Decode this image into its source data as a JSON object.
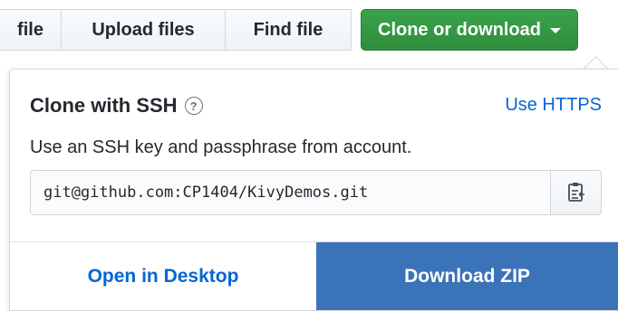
{
  "toolbar": {
    "file_label": "file",
    "upload_label": "Upload files",
    "find_label": "Find file",
    "clone_label": "Clone or download"
  },
  "panel": {
    "title": "Clone with SSH",
    "help_icon": "?",
    "switch_link": "Use HTTPS",
    "description": "Use an SSH key and passphrase from account.",
    "clone_url": "git@github.com:CP1404/KivyDemos.git",
    "copy_icon": "clipboard-icon",
    "open_desktop_label": "Open in Desktop",
    "download_zip_label": "Download ZIP"
  },
  "colors": {
    "clone_button": "#2f8d3c",
    "link": "#0366d6",
    "download_zip_bg": "#3b73b9"
  }
}
